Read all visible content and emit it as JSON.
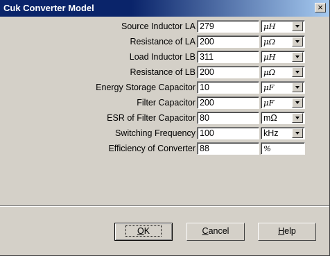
{
  "window": {
    "title": "Cuk Converter Model",
    "close_symbol": "×"
  },
  "rows": [
    {
      "label": "Source Inductor LA",
      "value": "279",
      "unit": "μH"
    },
    {
      "label": "Resistance of LA",
      "value": "200",
      "unit": "μΩ"
    },
    {
      "label": "Load Inductor LB",
      "value": "311",
      "unit": "μH"
    },
    {
      "label": "Resistance of LB",
      "value": "200",
      "unit": "μΩ"
    },
    {
      "label": "Energy Storage Capacitor",
      "value": "10",
      "unit": "μF"
    },
    {
      "label": "Filter Capacitor",
      "value": "200",
      "unit": "μF"
    },
    {
      "label": "ESR of Filter Capacitor",
      "value": "80",
      "unit": "mΩ"
    },
    {
      "label": "Switching Frequency",
      "value": "100",
      "unit": "kHz"
    },
    {
      "label": "Efficiency of Converter",
      "value": "88",
      "unit": "%"
    }
  ],
  "buttons": {
    "ok": {
      "mnemonic": "O",
      "rest": "K"
    },
    "cancel": {
      "mnemonic": "C",
      "rest": "ancel"
    },
    "help": {
      "mnemonic": "H",
      "rest": "elp"
    }
  }
}
